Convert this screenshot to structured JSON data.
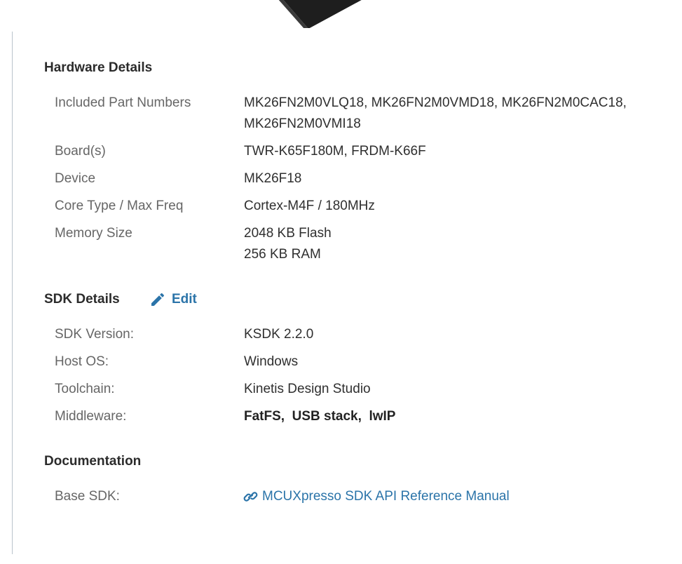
{
  "hardware": {
    "title": "Hardware Details",
    "rows": [
      {
        "label": "Included Part Numbers",
        "value_line1": "MK26FN2M0VLQ18, MK26FN2M0VMD18, MK26FN2M0CAC18,",
        "value_line2": "MK26FN2M0VMI18"
      },
      {
        "label": "Board(s)",
        "value": "TWR-K65F180M, FRDM-K66F"
      },
      {
        "label": "Device",
        "value": "MK26F18"
      },
      {
        "label": "Core Type / Max Freq",
        "value": "Cortex-M4F / 180MHz"
      },
      {
        "label": "Memory Size",
        "value_line1": "2048 KB Flash",
        "value_line2": "256 KB RAM"
      }
    ]
  },
  "sdk": {
    "title": "SDK Details",
    "edit_label": "Edit",
    "edit_icon": "pencil-icon",
    "rows": [
      {
        "label": "SDK Version:",
        "value": "KSDK 2.2.0"
      },
      {
        "label": "Host OS:",
        "value": "Windows"
      },
      {
        "label": "Toolchain:",
        "value": "Kinetis Design Studio"
      },
      {
        "label": "Middleware:",
        "items": [
          "FatFS,",
          "USB stack,",
          "lwIP"
        ]
      }
    ]
  },
  "documentation": {
    "title": "Documentation",
    "rows": [
      {
        "label": "Base SDK:",
        "link_text": "MCUXpresso SDK API Reference Manual",
        "link_icon": "link-icon"
      }
    ]
  },
  "colors": {
    "link": "#2b74a9",
    "label": "#666666",
    "rule": "#b9c4cc"
  }
}
